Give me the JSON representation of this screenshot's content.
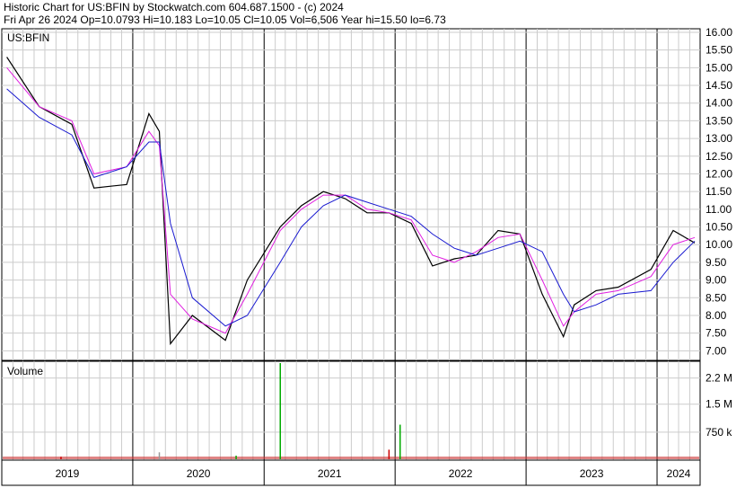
{
  "header": {
    "line1": "Historic Chart for US:BFIN by Stockwatch.com 604.687.1500 - (c) 2024",
    "line2": "Fri Apr 26 2024   Op=10.0793   Hi=10.183   Lo=10.05   Cl=10.05   Vol=6,506   Year hi=15.50   lo=6.73"
  },
  "chart_data": [
    {
      "type": "line",
      "name_label": "US:BFIN",
      "yticks": [
        "16.00",
        "15.50",
        "15.00",
        "14.50",
        "14.00",
        "13.50",
        "13.00",
        "12.50",
        "12.00",
        "11.50",
        "11.00",
        "10.50",
        "10.00",
        "9.50",
        "9.00",
        "8.50",
        "8.00",
        "7.50",
        "7.00"
      ],
      "ylim": [
        6.73,
        16.1
      ],
      "x": [
        "2019-01",
        "2019-04",
        "2019-07",
        "2019-09",
        "2019-12",
        "2020-02",
        "2020-03",
        "2020-04",
        "2020-06",
        "2020-09",
        "2020-11",
        "2021-02",
        "2021-04",
        "2021-06",
        "2021-08",
        "2021-10",
        "2021-12",
        "2022-02",
        "2022-04",
        "2022-06",
        "2022-08",
        "2022-10",
        "2022-12",
        "2023-02",
        "2023-04",
        "2023-05",
        "2023-07",
        "2023-09",
        "2023-12",
        "2024-02",
        "2024-04"
      ],
      "series": [
        {
          "values": [
            15.3,
            13.9,
            13.4,
            11.6,
            11.7,
            13.7,
            13.2,
            7.2,
            8.0,
            7.3,
            9.0,
            10.5,
            11.1,
            11.5,
            11.3,
            10.9,
            10.9,
            10.6,
            9.4,
            9.6,
            9.7,
            10.4,
            10.3,
            8.6,
            7.4,
            8.3,
            8.7,
            8.8,
            9.3,
            10.4,
            10.05
          ],
          "color": "#000000"
        },
        {
          "values": [
            15.0,
            13.9,
            13.5,
            12.0,
            12.2,
            13.2,
            12.8,
            8.6,
            7.9,
            7.5,
            8.6,
            10.4,
            11.0,
            11.4,
            11.4,
            11.0,
            10.9,
            10.7,
            9.7,
            9.5,
            9.8,
            10.2,
            10.3,
            9.0,
            7.7,
            8.1,
            8.6,
            8.7,
            9.1,
            10.0,
            10.2
          ],
          "color": "#e020e0"
        },
        {
          "values": [
            14.4,
            13.6,
            13.1,
            11.9,
            12.2,
            12.9,
            12.9,
            10.6,
            8.5,
            7.7,
            8.0,
            9.5,
            10.5,
            11.1,
            11.4,
            11.2,
            11.0,
            10.8,
            10.3,
            9.9,
            9.7,
            9.9,
            10.1,
            9.8,
            8.6,
            8.1,
            8.3,
            8.6,
            8.7,
            9.5,
            10.1
          ],
          "color": "#1a1ad0"
        }
      ]
    },
    {
      "type": "bar",
      "title": "Volume",
      "yticks": [
        "2.2 M",
        "1.5 M",
        "750 k"
      ],
      "ylim": [
        0,
        2600000
      ],
      "x_labels": [
        "2019",
        "2020",
        "2021",
        "2022",
        "2023",
        "2024"
      ],
      "spikes": [
        {
          "date": "2020-03",
          "value": 210000,
          "color": "#999999"
        },
        {
          "date": "2021-02",
          "value": 2600000,
          "color": "#00aa00"
        },
        {
          "date": "2021-12",
          "value": 280000,
          "color": "#cc0000"
        },
        {
          "date": "2022-01",
          "value": 950000,
          "color": "#00aa00"
        },
        {
          "date": "2019-06",
          "value": 90000,
          "color": "#cc0000"
        },
        {
          "date": "2020-10",
          "value": 120000,
          "color": "#00aa00"
        }
      ]
    }
  ]
}
